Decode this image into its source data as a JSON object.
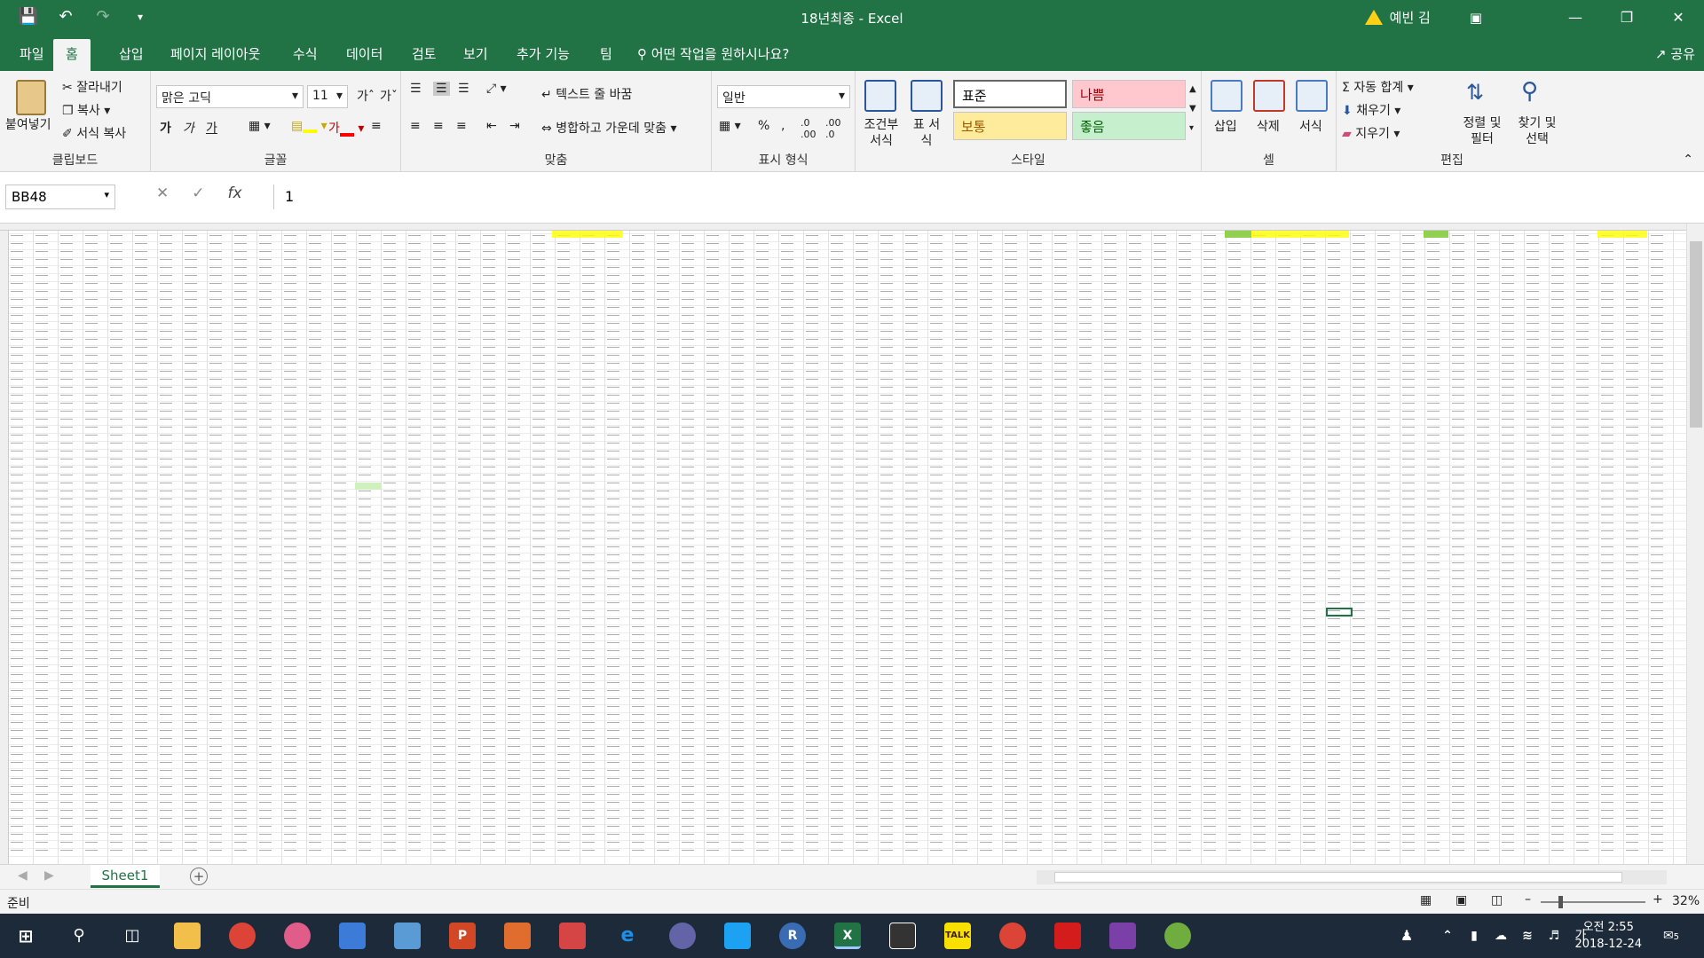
{
  "window": {
    "title": "18년최종 - Excel",
    "user": "예빈 김"
  },
  "tabs": [
    "파일",
    "홈",
    "삽입",
    "페이지 레이아웃",
    "수식",
    "데이터",
    "검토",
    "보기",
    "추가 기능",
    "팀"
  ],
  "tell_me": "어떤 작업을 원하시나요?",
  "share": "공유",
  "ribbon": {
    "clipboard": {
      "paste": "붙여넣기",
      "cut": "잘라내기",
      "copy": "복사",
      "format_painter": "서식 복사",
      "label": "클립보드"
    },
    "font": {
      "name": "맑은 고딕",
      "size": "11",
      "label": "글꼴",
      "bold": "가",
      "italic": "가",
      "underline": "가"
    },
    "alignment": {
      "wrap": "텍스트 줄 바꿈",
      "merge": "병합하고 가운데 맞춤",
      "label": "맞춤"
    },
    "number": {
      "format": "일반",
      "label": "표시 형식"
    },
    "styles": {
      "conditional": "조건부 서식",
      "table": "표 서식",
      "normal": "표준",
      "bad": "나쁨",
      "neutral": "보통",
      "good": "좋음",
      "label": "스타일"
    },
    "cells": {
      "insert": "삽입",
      "delete": "삭제",
      "format": "서식",
      "label": "셀"
    },
    "editing": {
      "autosum": "자동 합계",
      "fill": "채우기",
      "clear": "지우기",
      "sort": "정렬 및 필터",
      "find": "찾기 및 선택",
      "label": "편집"
    }
  },
  "formula_bar": {
    "name_box": "BB48",
    "fx": "fx",
    "value": "1"
  },
  "sheet": {
    "active_tab": "Sheet1"
  },
  "status": {
    "ready": "준비",
    "zoom": "32%"
  },
  "taskbar": {
    "time": "오전 2:55",
    "date": "2018-12-24",
    "ime": "가",
    "notifications": "5"
  },
  "colors": {
    "brand": "#217346",
    "bad_bg": "#ffc7ce",
    "neutral_bg": "#ffeb9c",
    "good_bg": "#c6efce",
    "highlight_yellow": "#ffff00",
    "highlight_green": "#92d050"
  }
}
